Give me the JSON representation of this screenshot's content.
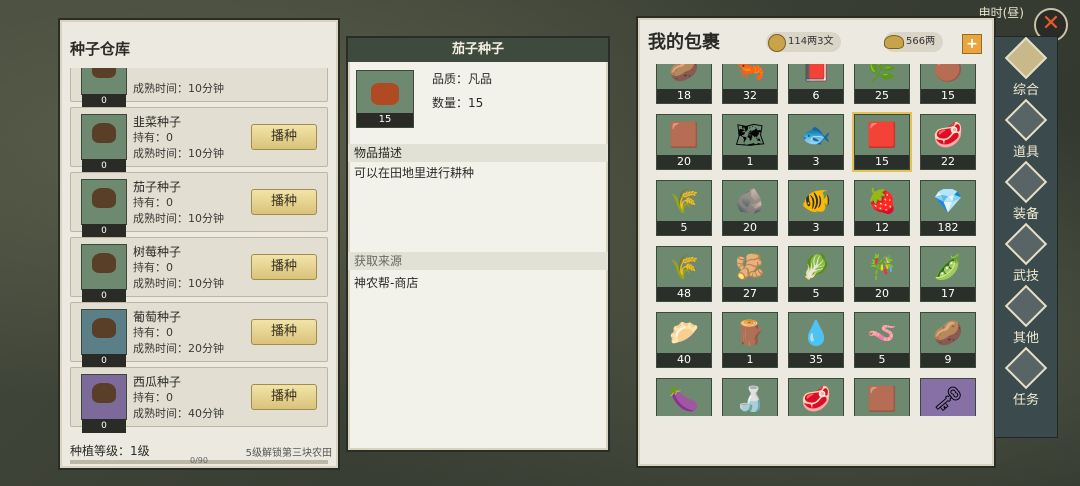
{
  "header": {
    "clock": "申时(昼)",
    "close_symbol": "✕"
  },
  "seed_warehouse": {
    "title": "种子仓库",
    "sow_label": "播种",
    "cards": [
      {
        "name": "",
        "count": "0",
        "have": "",
        "time": "成熟时间：10分钟",
        "icon_color": "green"
      },
      {
        "name": "韭菜种子",
        "count": "0",
        "have": "持有：0",
        "time": "成熟时间：10分钟",
        "icon_color": "green"
      },
      {
        "name": "茄子种子",
        "count": "0",
        "have": "持有：0",
        "time": "成熟时间：10分钟",
        "icon_color": "green"
      },
      {
        "name": "树莓种子",
        "count": "0",
        "have": "持有：0",
        "time": "成熟时间：10分钟",
        "icon_color": "green"
      },
      {
        "name": "葡萄种子",
        "count": "0",
        "have": "持有：0",
        "time": "成熟时间：20分钟",
        "icon_color": "blue"
      },
      {
        "name": "西瓜种子",
        "count": "0",
        "have": "持有：0",
        "time": "成熟时间：40分钟",
        "icon_color": "purple"
      }
    ],
    "level_label": "种植等级：1级",
    "unlock_hint": "5级解锁第三块农田",
    "progress_text": "0/90",
    "progress_fraction": 0.0
  },
  "detail": {
    "title": "茄子种子",
    "count": "15",
    "quality": "品质：凡品",
    "quantity": "数量：15",
    "desc_header": "物品描述",
    "desc": "可以在田地里进行耕种",
    "source_header": "获取来源",
    "source": "神农帮-商店"
  },
  "bag": {
    "title": "我的包裹",
    "coins": "114两3文",
    "silver": "566两",
    "add_symbol": "+",
    "slots": [
      {
        "count": "18",
        "icon": "root-icon",
        "glyph": "🥔"
      },
      {
        "count": "32",
        "icon": "fish-tail-icon",
        "glyph": "🦐"
      },
      {
        "count": "6",
        "icon": "book-icon",
        "glyph": "📕"
      },
      {
        "count": "25",
        "icon": "herb-icon",
        "glyph": "🌿"
      },
      {
        "count": "15",
        "icon": "seed-pile-icon",
        "glyph": "🟤"
      },
      {
        "count": "20",
        "icon": "seed-pile-icon",
        "glyph": "🟫"
      },
      {
        "count": "1",
        "icon": "map-icon",
        "glyph": "🗺"
      },
      {
        "count": "3",
        "icon": "fish-icon",
        "glyph": "🐟"
      },
      {
        "count": "15",
        "icon": "eggplant-seed-icon",
        "glyph": "🟥",
        "selected": true
      },
      {
        "count": "22",
        "icon": "meat-icon",
        "glyph": "🥩"
      },
      {
        "count": "5",
        "icon": "chive-icon",
        "glyph": "🌾"
      },
      {
        "count": "20",
        "icon": "ore-icon",
        "glyph": "🪨"
      },
      {
        "count": "3",
        "icon": "fish-icon",
        "glyph": "🐠"
      },
      {
        "count": "12",
        "icon": "raspberry-icon",
        "glyph": "🍓"
      },
      {
        "count": "182",
        "icon": "jade-icon",
        "glyph": "💎"
      },
      {
        "count": "48",
        "icon": "wheat-icon",
        "glyph": "🌾"
      },
      {
        "count": "27",
        "icon": "ginger-icon",
        "glyph": "🫚"
      },
      {
        "count": "5",
        "icon": "greens-icon",
        "glyph": "🥬"
      },
      {
        "count": "20",
        "icon": "bamboo-icon",
        "glyph": "🎋"
      },
      {
        "count": "17",
        "icon": "gourd-icon",
        "glyph": "🫛"
      },
      {
        "count": "40",
        "icon": "dumpling-icon",
        "glyph": "🥟"
      },
      {
        "count": "1",
        "icon": "firewood-icon",
        "glyph": "🪵"
      },
      {
        "count": "35",
        "icon": "water-drop-icon",
        "glyph": "💧"
      },
      {
        "count": "5",
        "icon": "worm-icon",
        "glyph": "🪱"
      },
      {
        "count": "9",
        "icon": "potato-icon",
        "glyph": "🥔"
      },
      {
        "count": "",
        "icon": "eggplant-icon",
        "glyph": "🍆"
      },
      {
        "count": "",
        "icon": "wine-jar-icon",
        "glyph": "🍶"
      },
      {
        "count": "",
        "icon": "meat-icon",
        "glyph": "🥩"
      },
      {
        "count": "",
        "icon": "seed-pile-icon",
        "glyph": "🟫"
      },
      {
        "count": "",
        "icon": "key-icon",
        "glyph": "🗝",
        "purple": true
      }
    ]
  },
  "nav": [
    {
      "label": "综合",
      "icon": "grid-icon",
      "active": true
    },
    {
      "label": "道具",
      "icon": "bag-icon"
    },
    {
      "label": "装备",
      "icon": "armor-icon"
    },
    {
      "label": "武技",
      "icon": "scroll-icon"
    },
    {
      "label": "其他",
      "icon": "compass-icon"
    },
    {
      "label": "任务",
      "icon": "task-icon"
    }
  ]
}
